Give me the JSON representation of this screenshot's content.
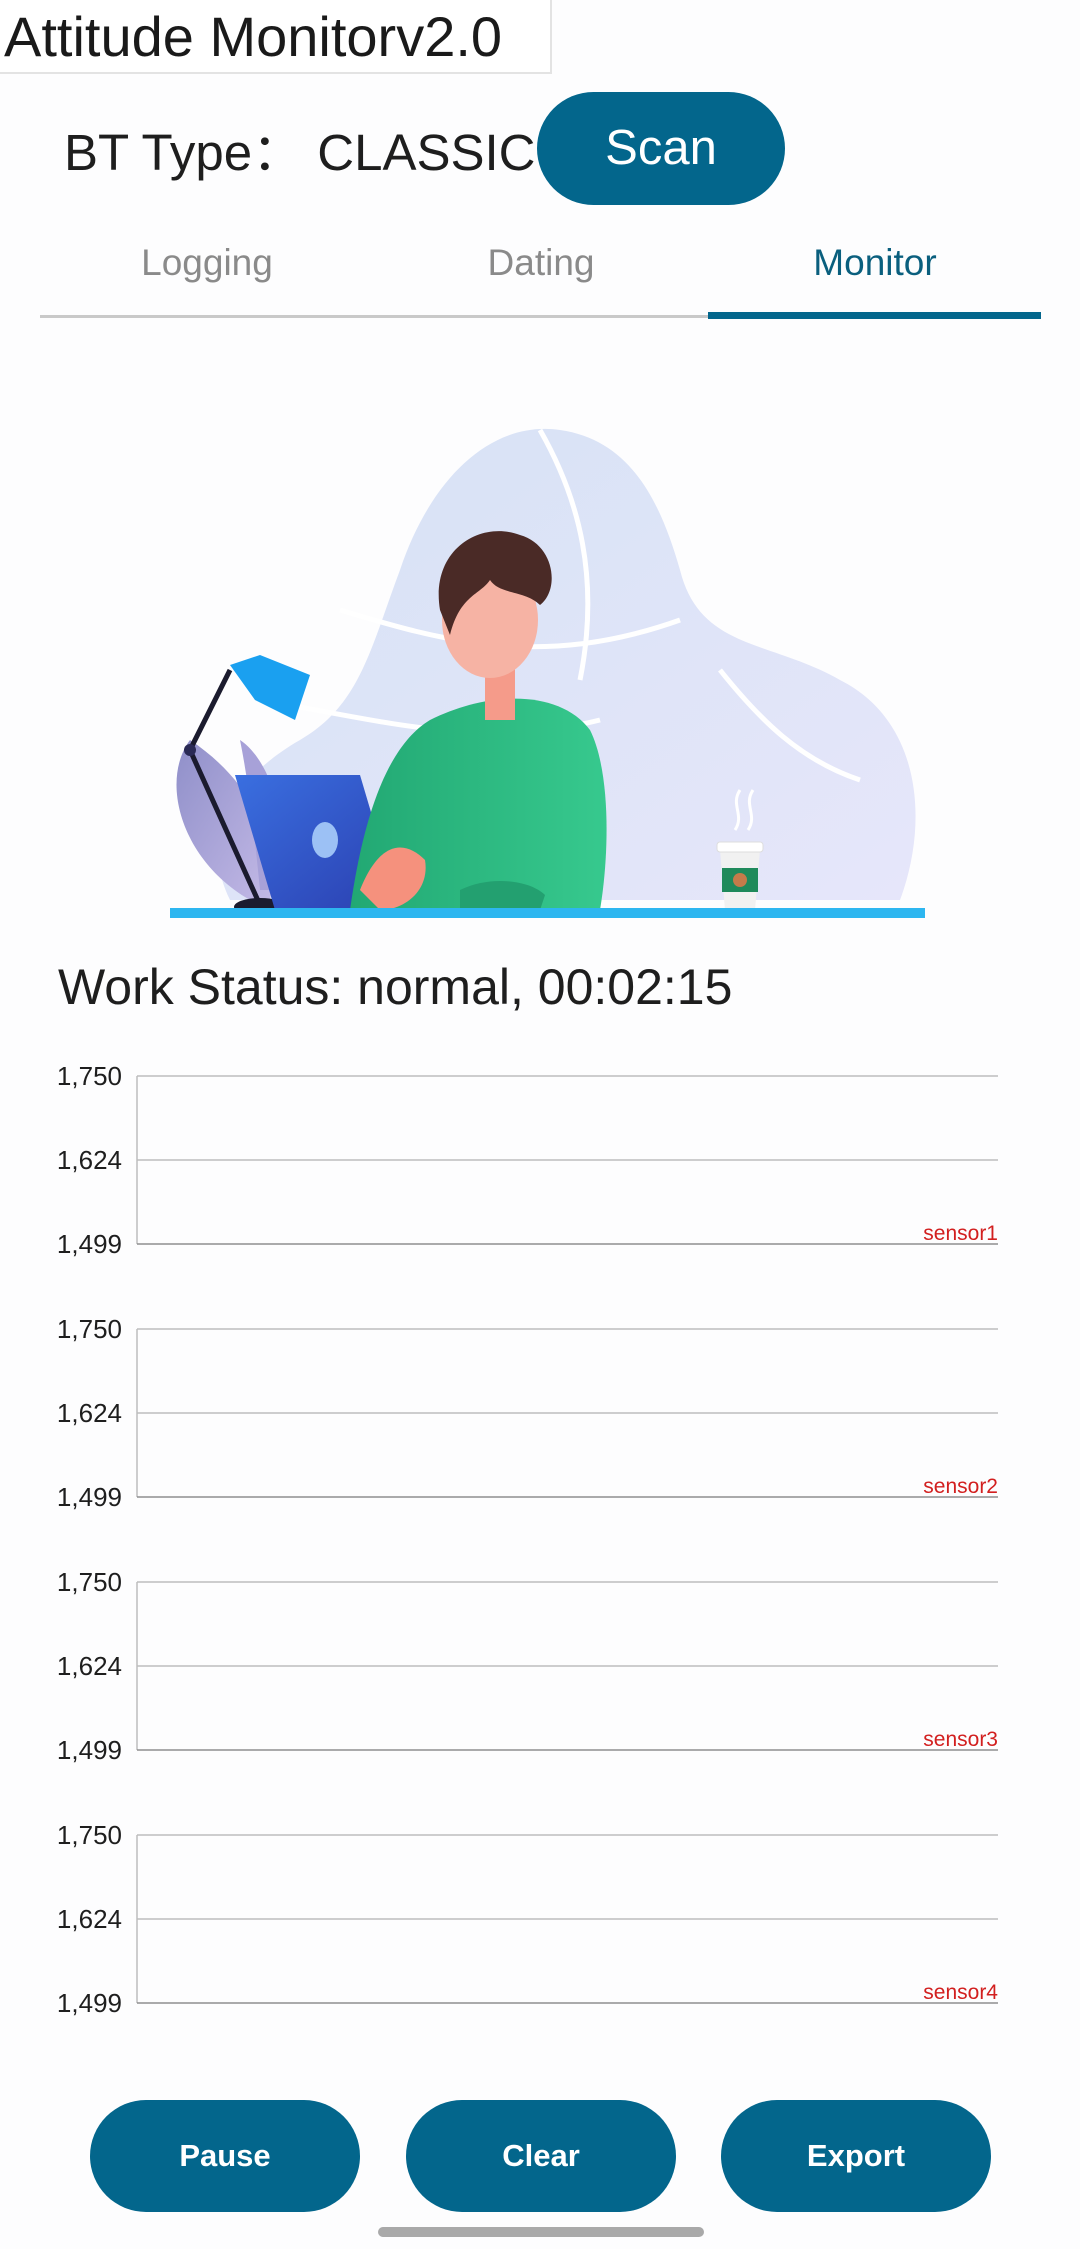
{
  "app": {
    "title": "Attitude Monitorv2.0"
  },
  "connection": {
    "bt_type_label": "BT Type：",
    "bt_type_value": "CLASSIC",
    "scan_label": "Scan"
  },
  "tabs": [
    {
      "label": "Logging",
      "active": false
    },
    {
      "label": "Dating",
      "active": false
    },
    {
      "label": "Monitor",
      "active": true
    }
  ],
  "status": {
    "text": "Work Status: normal, 00:02:15"
  },
  "colors": {
    "accent": "#03668c",
    "series_label": "#d21f1f",
    "grid": "#bdbdbd"
  },
  "chart_data": [
    {
      "type": "line",
      "series": [
        {
          "name": "sensor1",
          "values": []
        }
      ],
      "y_ticks": [
        "1,750",
        "1,624",
        "1,499"
      ],
      "ylim": [
        1499,
        1750
      ]
    },
    {
      "type": "line",
      "series": [
        {
          "name": "sensor2",
          "values": []
        }
      ],
      "y_ticks": [
        "1,750",
        "1,624",
        "1,499"
      ],
      "ylim": [
        1499,
        1750
      ]
    },
    {
      "type": "line",
      "series": [
        {
          "name": "sensor3",
          "values": []
        }
      ],
      "y_ticks": [
        "1,750",
        "1,624",
        "1,499"
      ],
      "ylim": [
        1499,
        1750
      ]
    },
    {
      "type": "line",
      "series": [
        {
          "name": "sensor4",
          "values": []
        }
      ],
      "y_ticks": [
        "1,750",
        "1,624",
        "1,499"
      ],
      "ylim": [
        1499,
        1750
      ]
    }
  ],
  "buttons": {
    "pause": "Pause",
    "clear": "Clear",
    "export": "Export"
  }
}
